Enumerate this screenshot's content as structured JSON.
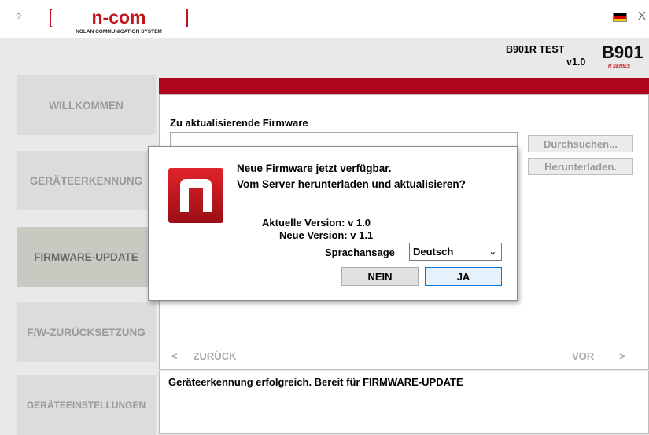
{
  "window": {
    "help_label": "?",
    "close_label": "X",
    "logo_text": "n-com",
    "logo_subtitle": "NOLAN COMMUNICATION SYSTEM",
    "flag_colors": [
      "#000000",
      "#dd0000",
      "#ffce00"
    ]
  },
  "device": {
    "name": "B901R TEST",
    "version": "v1.0",
    "model_logo": "B901",
    "model_series": "R SERIES"
  },
  "nav": {
    "items": [
      {
        "label": "WILLKOMMEN",
        "active": false
      },
      {
        "label": "GERÄTEERKENNUNG",
        "active": false
      },
      {
        "label": "FIRMWARE-UPDATE",
        "active": true
      },
      {
        "label": "F/W-ZURÜCKSETZUNG",
        "active": false
      },
      {
        "label": "GERÄTEEINSTELLUNGEN",
        "active": false
      }
    ]
  },
  "content": {
    "firmware_label": "Zu aktualisierende Firmware",
    "firmware_value": "",
    "browse_label": "Durchsuchen...",
    "download_label": "Herunterladen.",
    "back_arrow": "<",
    "back_label": "ZURÜCK",
    "forward_label": "VOR",
    "forward_arrow": ">"
  },
  "status": {
    "text": "Geräteerkennung erfolgreich. Bereit für FIRMWARE-UPDATE"
  },
  "dialog": {
    "message_line1": "Neue Firmware jetzt verfügbar.",
    "message_line2": "Vom Server herunterladen und aktualisieren?",
    "current_version": "Aktuelle Version: v 1.0",
    "new_version": "Neue Version: v 1.1",
    "language_label": "Sprachansage",
    "language_value": "Deutsch",
    "no_label": "NEIN",
    "yes_label": "JA",
    "accent_color": "#c0141e"
  }
}
